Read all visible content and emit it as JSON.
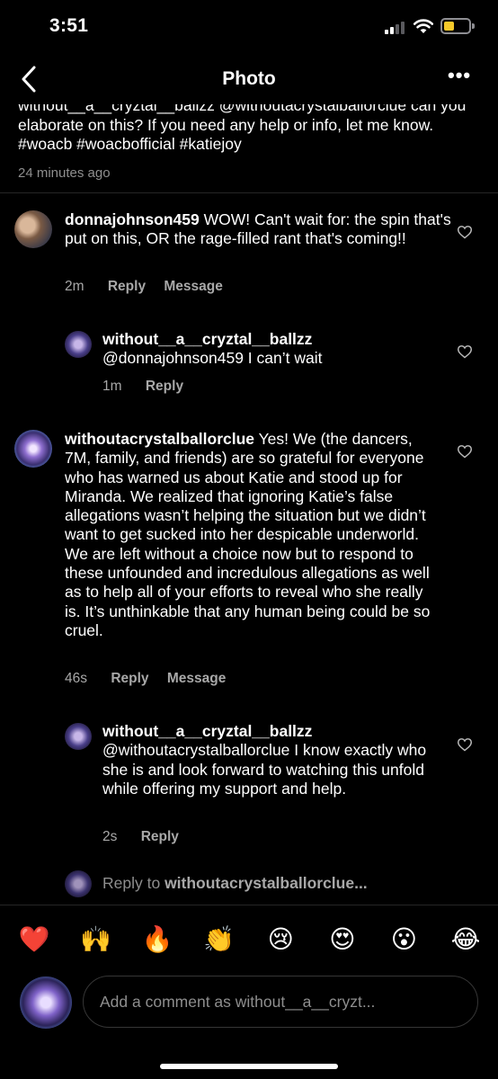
{
  "status_bar": {
    "time": "3:51"
  },
  "nav": {
    "title": "Photo"
  },
  "caption": {
    "text": "without__a__cryztal__ballzz @withoutacrystalballorclue can you elaborate on this? If you need any help or info, let me know. #woacb #woacbofficial #katiejoy",
    "timestamp": "24 minutes ago"
  },
  "comments": [
    {
      "username": "donnajohnson459",
      "text": "WOW! Can't wait for: the spin that's put on this, OR the rage-filled rant that's coming!!",
      "time": "2m",
      "reply_label": "Reply",
      "message_label": "Message"
    },
    {
      "username": "without__a__cryztal__ballzz",
      "text": "@donnajohnson459 I can’t wait",
      "time": "1m",
      "reply_label": "Reply"
    },
    {
      "username": "withoutacrystalballorclue",
      "text": "Yes! We (the dancers, 7M, family, and friends) are so grateful for everyone who has warned us about Katie and stood up for Miranda. We realized that ignoring Katie’s false allegations wasn’t helping the situation but we didn’t want to get sucked into her despicable underworld. We are left without a choice now but to respond to these unfounded and incredulous allegations as well as to help all of your efforts to reveal who she really is. It’s unthinkable that any human being could be so cruel.",
      "time": "46s",
      "reply_label": "Reply",
      "message_label": "Message"
    },
    {
      "username": "without__a__cryztal__ballzz",
      "text": "@withoutacrystalballorclue I know exactly who she is and look forward to watching this unfold while offering my support and help.",
      "time": "2s",
      "reply_label": "Reply"
    }
  ],
  "reply_to": {
    "prefix": "Reply to ",
    "username": "withoutacrystalballorclue..."
  },
  "emojis": [
    "❤️",
    "🙌",
    "🔥",
    "👏",
    "😢",
    "😍",
    "😮",
    "😂"
  ],
  "composer": {
    "placeholder": "Add a comment as without__a__cryzt..."
  },
  "colors": {
    "background": "#000000",
    "secondary_text": "#a8a8a8",
    "divider": "#262626"
  }
}
